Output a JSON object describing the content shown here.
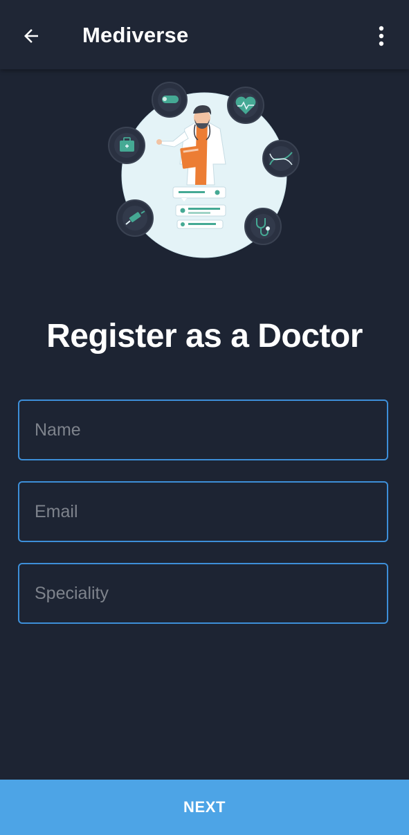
{
  "appbar": {
    "title": "Mediverse",
    "back_icon": "arrow-left-icon",
    "more_icon": "more-vertical-icon"
  },
  "page": {
    "title": "Register as a Doctor"
  },
  "form": {
    "name_placeholder": "Name",
    "email_placeholder": "Email",
    "speciality_placeholder": "Speciality",
    "name_value": "",
    "email_value": "",
    "speciality_value": ""
  },
  "actions": {
    "next_label": "NEXT"
  },
  "colors": {
    "background": "#1d2433",
    "appbar": "#1f2635",
    "field_border": "#3d8fd9",
    "primary_button": "#4da4e6",
    "illustration_circle": "#e4f3f7",
    "teal": "#45a994",
    "orange": "#ec7d34"
  }
}
